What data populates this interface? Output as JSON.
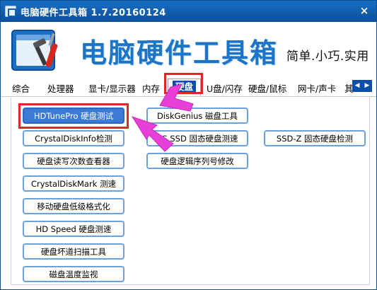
{
  "window": {
    "title": "电脑硬件工具箱 1.7.20160124",
    "close_glyph": "×"
  },
  "banner": {
    "title": "电脑硬件工具箱",
    "slogan": "简单.小巧.实用"
  },
  "tabs": [
    {
      "label": "综合"
    },
    {
      "label": "处理器"
    },
    {
      "label": "显卡/显示器"
    },
    {
      "label": "内存"
    },
    {
      "label": "硬盘",
      "active": true
    },
    {
      "label": "U盘/闪存"
    },
    {
      "label": "硬盘/鼠标"
    },
    {
      "label": "网卡/声卡"
    },
    {
      "label": "其"
    }
  ],
  "tab_scroll": {
    "left": "◀",
    "right": "▶"
  },
  "buttons": {
    "col1": [
      {
        "label": "HDTunePro 硬盘测试",
        "selected": true
      },
      {
        "label": "CrystalDiskInfo检测"
      },
      {
        "label": "硬盘读写次数查看器"
      },
      {
        "label": "CrystalDiskMark 测速"
      },
      {
        "label": "移动硬盘低级格式化"
      },
      {
        "label": "HD Speed 硬盘测速"
      },
      {
        "label": "硬盘坏道扫描工具"
      },
      {
        "label": "磁盘温度监视"
      }
    ],
    "col2": [
      {
        "label": "DiskGenius 磁盘工具"
      },
      {
        "label": "AS SSD 固态硬盘测速"
      },
      {
        "label": "硬盘逻辑序列号修改"
      }
    ],
    "col3": [
      {
        "label": "SSD-Z 固态硬盘检测"
      }
    ]
  },
  "colors": {
    "accent": "#1c74c6",
    "title_bar": "#0a4f9c",
    "annotation_red": "#e02727",
    "annotation_magenta": "#e83fd8"
  }
}
